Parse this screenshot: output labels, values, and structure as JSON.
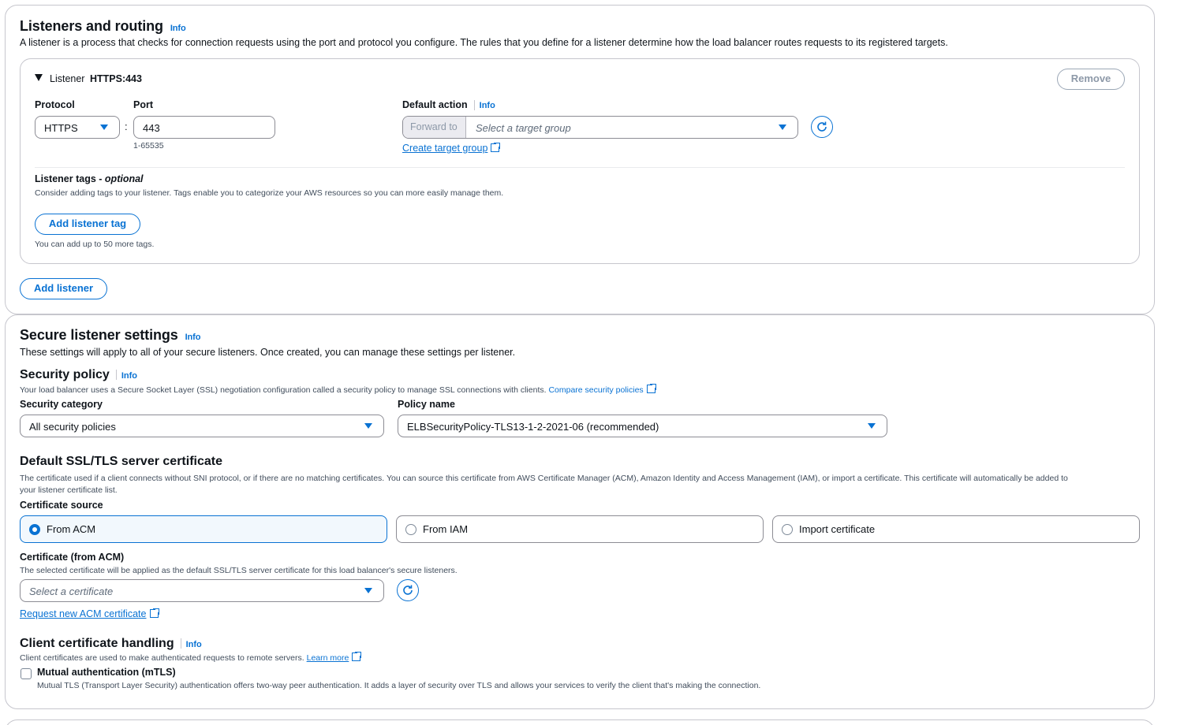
{
  "listeners": {
    "title": "Listeners and routing",
    "info": "Info",
    "description": "A listener is a process that checks for connection requests using the port and protocol you configure. The rules that you define for a listener determine how the load balancer routes requests to its registered targets.",
    "listener": {
      "prefix": "Listener",
      "name": "HTTPS:443",
      "remove_label": "Remove",
      "protocol_label": "Protocol",
      "protocol_value": "HTTPS",
      "port_label": "Port",
      "port_value": "443",
      "port_hint": "1-65535",
      "colon": ":",
      "default_action_label": "Default action",
      "default_action_info": "Info",
      "forward_to": "Forward to",
      "target_group_placeholder": "Select a target group",
      "create_target_group": "Create target group",
      "tags_label": "Listener tags - ",
      "tags_optional": "optional",
      "tags_description": "Consider adding tags to your listener. Tags enable you to categorize your AWS resources so you can more easily manage them.",
      "add_tag_label": "Add listener tag",
      "tags_hint": "You can add up to 50 more tags."
    },
    "add_listener_label": "Add listener"
  },
  "secure": {
    "title": "Secure listener settings",
    "info": "Info",
    "description": "These settings will apply to all of your secure listeners. Once created, you can manage these settings per listener.",
    "policy": {
      "title": "Security policy",
      "info": "Info",
      "description": "Your load balancer uses a Secure Socket Layer (SSL) negotiation configuration called a security policy to manage SSL connections with clients.",
      "compare_link": "Compare security policies",
      "category_label": "Security category",
      "category_value": "All security policies",
      "name_label": "Policy name",
      "name_value": "ELBSecurityPolicy-TLS13-1-2-2021-06 (recommended)"
    },
    "cert": {
      "title": "Default SSL/TLS server certificate",
      "description_line1": "The certificate used if a client connects without SNI protocol, or if there are no matching certificates. You can source this certificate from AWS Certificate Manager (ACM), Amazon Identity and Access Management (IAM), or import a certificate. This certificate will automatically be added to",
      "description_line2": "your listener certificate list.",
      "source_label": "Certificate source",
      "sources": [
        "From ACM",
        "From IAM",
        "Import certificate"
      ],
      "selected_source": "From ACM",
      "acm_label": "Certificate (from ACM)",
      "acm_description": "The selected certificate will be applied as the default SSL/TLS server certificate for this load balancer's secure listeners.",
      "acm_placeholder": "Select a certificate",
      "request_link": "Request new ACM certificate"
    },
    "client": {
      "title": "Client certificate handling",
      "info": "Info",
      "description": "Client certificates are used to make authenticated requests to remote servers.",
      "learn_more": "Learn more",
      "mtls_label": "Mutual authentication (mTLS)",
      "mtls_description": "Mutual TLS (Transport Layer Security) authentication offers two-way peer authentication. It adds a layer of security over TLS and allows your services to verify the client that's making the connection.",
      "mtls_checked": false
    }
  },
  "colors": {
    "accent": "#0972d3",
    "border": "#8c8c94",
    "selected_bg": "#f2f8fd"
  }
}
